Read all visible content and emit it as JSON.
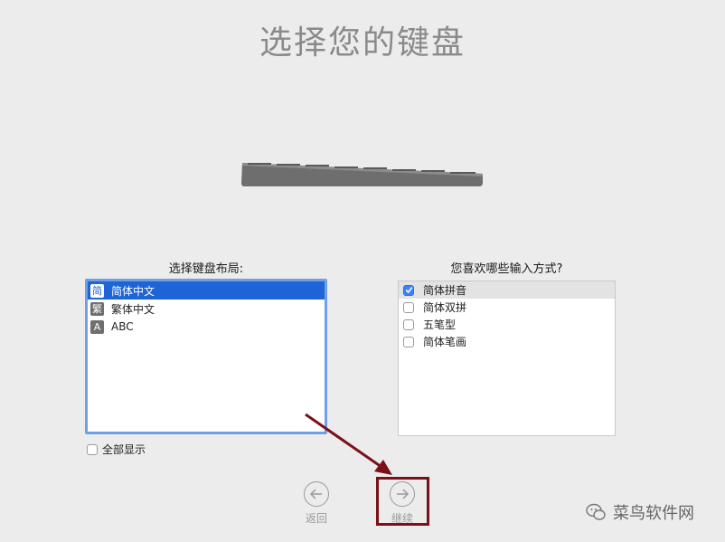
{
  "title": "选择您的键盘",
  "layout_section": {
    "label": "选择键盘布局:",
    "items": [
      {
        "badge": "简",
        "label": "简体中文",
        "selected": true
      },
      {
        "badge": "繁",
        "label": "繁体中文",
        "selected": false
      },
      {
        "badge": "A",
        "label": "ABC",
        "selected": false
      }
    ],
    "show_all_label": "全部显示"
  },
  "input_section": {
    "label": "您喜欢哪些输入方式?",
    "items": [
      {
        "label": "简体拼音",
        "checked": true
      },
      {
        "label": "简体双拼",
        "checked": false
      },
      {
        "label": "五笔型",
        "checked": false
      },
      {
        "label": "简体笔画",
        "checked": false
      }
    ]
  },
  "nav": {
    "back_label": "返回",
    "continue_label": "继续"
  },
  "watermark": {
    "text": "菜鸟软件网"
  },
  "colors": {
    "selection": "#1e64d6",
    "highlight_box": "#7a1018",
    "arrow": "#7a1018"
  }
}
